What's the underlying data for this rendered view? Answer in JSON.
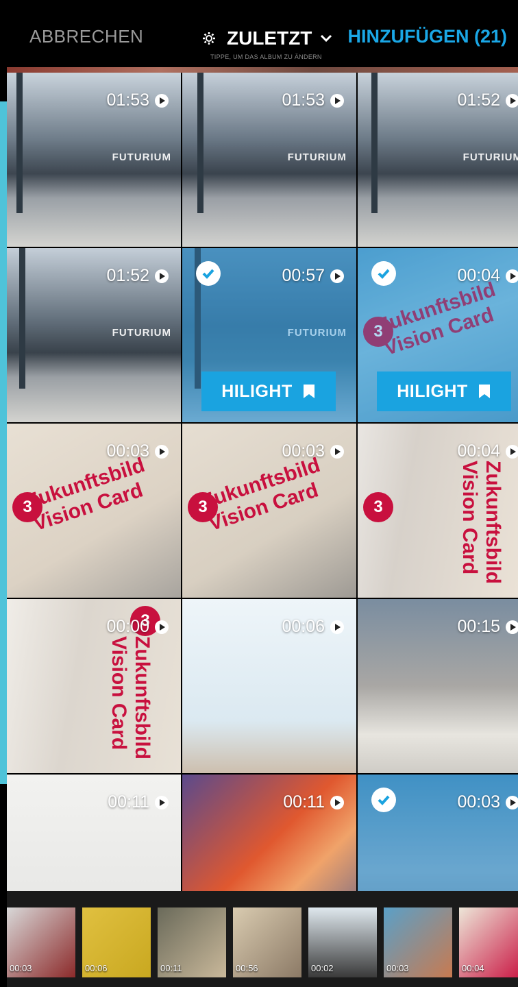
{
  "header": {
    "cancel_label": "ABBRECHEN",
    "album_label": "ZULETZT",
    "album_hint": "TIPPE, UM DAS ALBUM ZU ÄNDERN",
    "add_label": "HINZUFÜGEN (21)"
  },
  "tiles": [
    {
      "duration": "01:53",
      "selected": false,
      "hilight": ""
    },
    {
      "duration": "01:53",
      "selected": false,
      "hilight": ""
    },
    {
      "duration": "01:52",
      "selected": false,
      "hilight": ""
    },
    {
      "duration": "01:52",
      "selected": false,
      "hilight": ""
    },
    {
      "duration": "00:57",
      "selected": true,
      "hilight": "HILIGHT"
    },
    {
      "duration": "00:04",
      "selected": true,
      "hilight": "HILIGHT"
    },
    {
      "duration": "00:03",
      "selected": false,
      "hilight": ""
    },
    {
      "duration": "00:03",
      "selected": false,
      "hilight": ""
    },
    {
      "duration": "00:04",
      "selected": false,
      "hilight": ""
    },
    {
      "duration": "00:00",
      "selected": false,
      "hilight": ""
    },
    {
      "duration": "00:06",
      "selected": false,
      "hilight": ""
    },
    {
      "duration": "00:15",
      "selected": false,
      "hilight": ""
    },
    {
      "duration": "00:11",
      "selected": false,
      "hilight": ""
    },
    {
      "duration": "00:11",
      "selected": false,
      "hilight": ""
    },
    {
      "duration": "00:03",
      "selected": true,
      "hilight": ""
    }
  ],
  "picture_text": {
    "futurium": "FUTURIUM",
    "card_title_1": "Zukunftsbild",
    "card_title_2": "Vision Card",
    "card_number": "3"
  },
  "thumbnails": [
    {
      "duration": "00:03"
    },
    {
      "duration": "00:06"
    },
    {
      "duration": "00:11"
    },
    {
      "duration": "00:56"
    },
    {
      "duration": "00:02"
    },
    {
      "duration": "00:03"
    },
    {
      "duration": "00:04"
    }
  ],
  "colors": {
    "accent": "#1aa7e6",
    "hilight_bg": "#1aa3e0",
    "side_strip": "#4fc3d9"
  }
}
